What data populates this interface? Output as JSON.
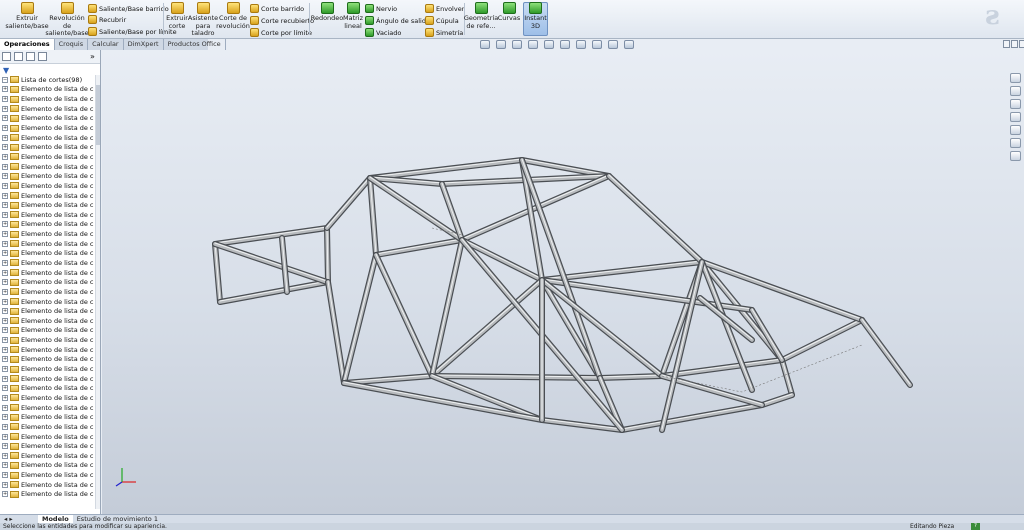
{
  "ribbon": {
    "extrude_boss": "Extruir saliente/base",
    "revolve_boss": "Revolución de saliente/base",
    "swept_boss": "Saliente/Base barrido",
    "loft": "Recubrir",
    "boundary_boss": "Saliente/Base por límite",
    "extrude_cut": "Extruir corte",
    "hole_wizard": "Asistente para taladro",
    "revolve_cut": "Corte de revolución",
    "swept_cut": "Corte barrido",
    "lofted_cut": "Corte recubierto",
    "boundary_cut": "Corte por límite",
    "fillet": "Redondeo",
    "linear_pattern": "Matriz lineal",
    "rib": "Nervio",
    "draft": "Ángulo de salida",
    "shell": "Vaciado",
    "wrap": "Envolver",
    "dome": "Cúpula",
    "mirror": "Simetría",
    "ref_geometry": "Geometría de refe...",
    "curves": "Curvas",
    "instant3d": "Instant 3D"
  },
  "tabs": [
    "Operaciones",
    "Croquis",
    "Calcular",
    "DimXpert",
    "Productos Office"
  ],
  "tree": {
    "root": "Lista de cortes(98)",
    "item_label": "Elemento de lista de c"
  },
  "bottom_tabs": [
    "Modelo",
    "Estudio de movimiento 1"
  ],
  "status": {
    "message": "Seleccione las entidades para modificar su apariencia.",
    "mode": "Editando Pieza",
    "help": "?"
  },
  "colors": {
    "accent": "#2f61b5",
    "tube": "#a7abaf"
  }
}
